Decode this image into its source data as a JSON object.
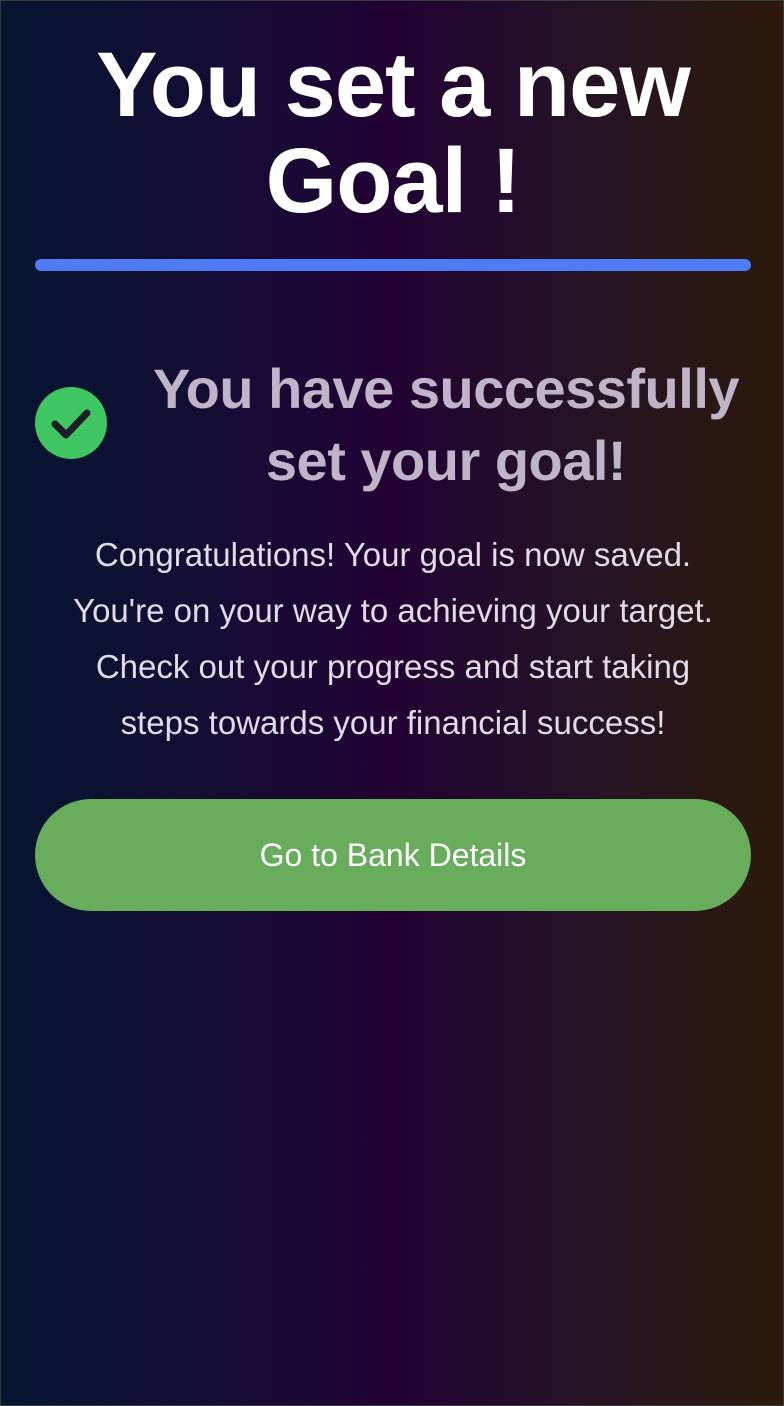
{
  "header": {
    "title_lines": [
      "You set a new",
      "Goal !"
    ]
  },
  "success": {
    "icon": "check-circle-icon",
    "heading_lines": [
      "You have successfully",
      "set your goal!"
    ]
  },
  "message": {
    "lines": [
      "Congratulations! Your goal is now saved.",
      "You're on your way to achieving your target.",
      "Check out your progress and start taking",
      "steps towards your financial success!"
    ]
  },
  "actions": {
    "primary_label": "Go to Bank Details"
  },
  "colors": {
    "accent_bar": "#4f7bf5",
    "success_green": "#40c661",
    "button_green": "#67ad5b",
    "heading_muted": "#bfb4c8",
    "body_text": "#e0dbe6",
    "check_mark": "#1c1c2a"
  }
}
